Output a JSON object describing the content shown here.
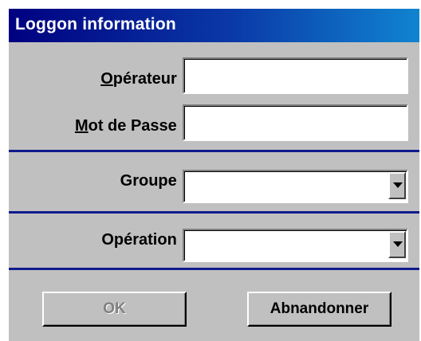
{
  "window": {
    "title": "Loggon information"
  },
  "form": {
    "operateur": {
      "label_first": "O",
      "label_rest": "pérateur :",
      "value": ""
    },
    "mot_de_passe": {
      "label_first": "M",
      "label_rest": "ot de Passe :",
      "value": ""
    },
    "groupe": {
      "label": "Groupe :",
      "selected": ""
    },
    "operation": {
      "label": "Opération :",
      "selected": ""
    }
  },
  "buttons": {
    "ok_label": "OK",
    "ok_enabled": false,
    "cancel_label": "Abnandonner"
  },
  "icons": {
    "dropdown": "chevron-down-icon"
  },
  "colors": {
    "title_gradient_start": "#000080",
    "title_gradient_end": "#1084d0",
    "separator": "#0f1c8c",
    "face": "#c0c0c0"
  }
}
